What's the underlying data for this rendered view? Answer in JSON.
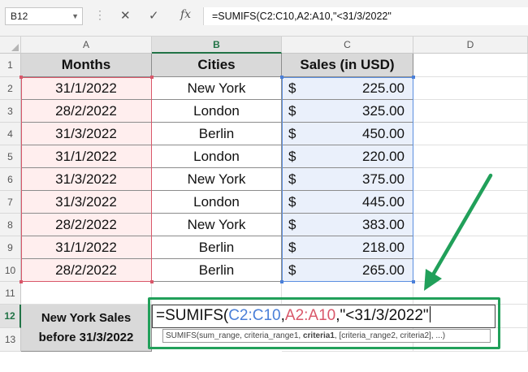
{
  "formula_bar": {
    "name_box": "B12",
    "cancel_icon": "✕",
    "enter_icon": "✓",
    "fx_label": "fx",
    "formula": "=SUMIFS(C2:C10,A2:A10,\"<31/3/2022\""
  },
  "columns": [
    "A",
    "B",
    "C",
    "D"
  ],
  "rows": [
    "1",
    "2",
    "3",
    "4",
    "5",
    "6",
    "7",
    "8",
    "9",
    "10",
    "11",
    "12",
    "13"
  ],
  "table": {
    "headers": [
      "Months",
      "Cities",
      "Sales (in USD)"
    ],
    "currency_symbol": "$",
    "rows": [
      {
        "month": "31/1/2022",
        "city": "New York",
        "sales": "225.00"
      },
      {
        "month": "28/2/2022",
        "city": "London",
        "sales": "325.00"
      },
      {
        "month": "31/3/2022",
        "city": "Berlin",
        "sales": "450.00"
      },
      {
        "month": "31/1/2022",
        "city": "London",
        "sales": "220.00"
      },
      {
        "month": "31/3/2022",
        "city": "New York",
        "sales": "375.00"
      },
      {
        "month": "31/3/2022",
        "city": "London",
        "sales": "445.00"
      },
      {
        "month": "28/2/2022",
        "city": "New York",
        "sales": "383.00"
      },
      {
        "month": "31/1/2022",
        "city": "Berlin",
        "sales": "218.00"
      },
      {
        "month": "28/2/2022",
        "city": "Berlin",
        "sales": "265.00"
      }
    ]
  },
  "summary": {
    "label_line1": "New York Sales",
    "label_line2": "before 31/3/2022"
  },
  "editing": {
    "part_prefix": "=SUMIFS(",
    "part_range1": "C2:C10",
    "sep1": ",",
    "part_range2": "A2:A10",
    "part_suffix": ",\"<31/3/2022\"",
    "range1_color": "#4a7fd8",
    "range2_color": "#d9576a"
  },
  "tooltip": {
    "pre": "SUMIFS(sum_range, criteria_range1, ",
    "bold": "criteria1",
    "post": ", [criteria_range2, criteria2], ...)"
  },
  "colors": {
    "accent_green": "#21a05a",
    "header_fill": "#d9d9d9",
    "pink_fill": "#ffeeee",
    "blue_fill": "#eaf0fb"
  }
}
